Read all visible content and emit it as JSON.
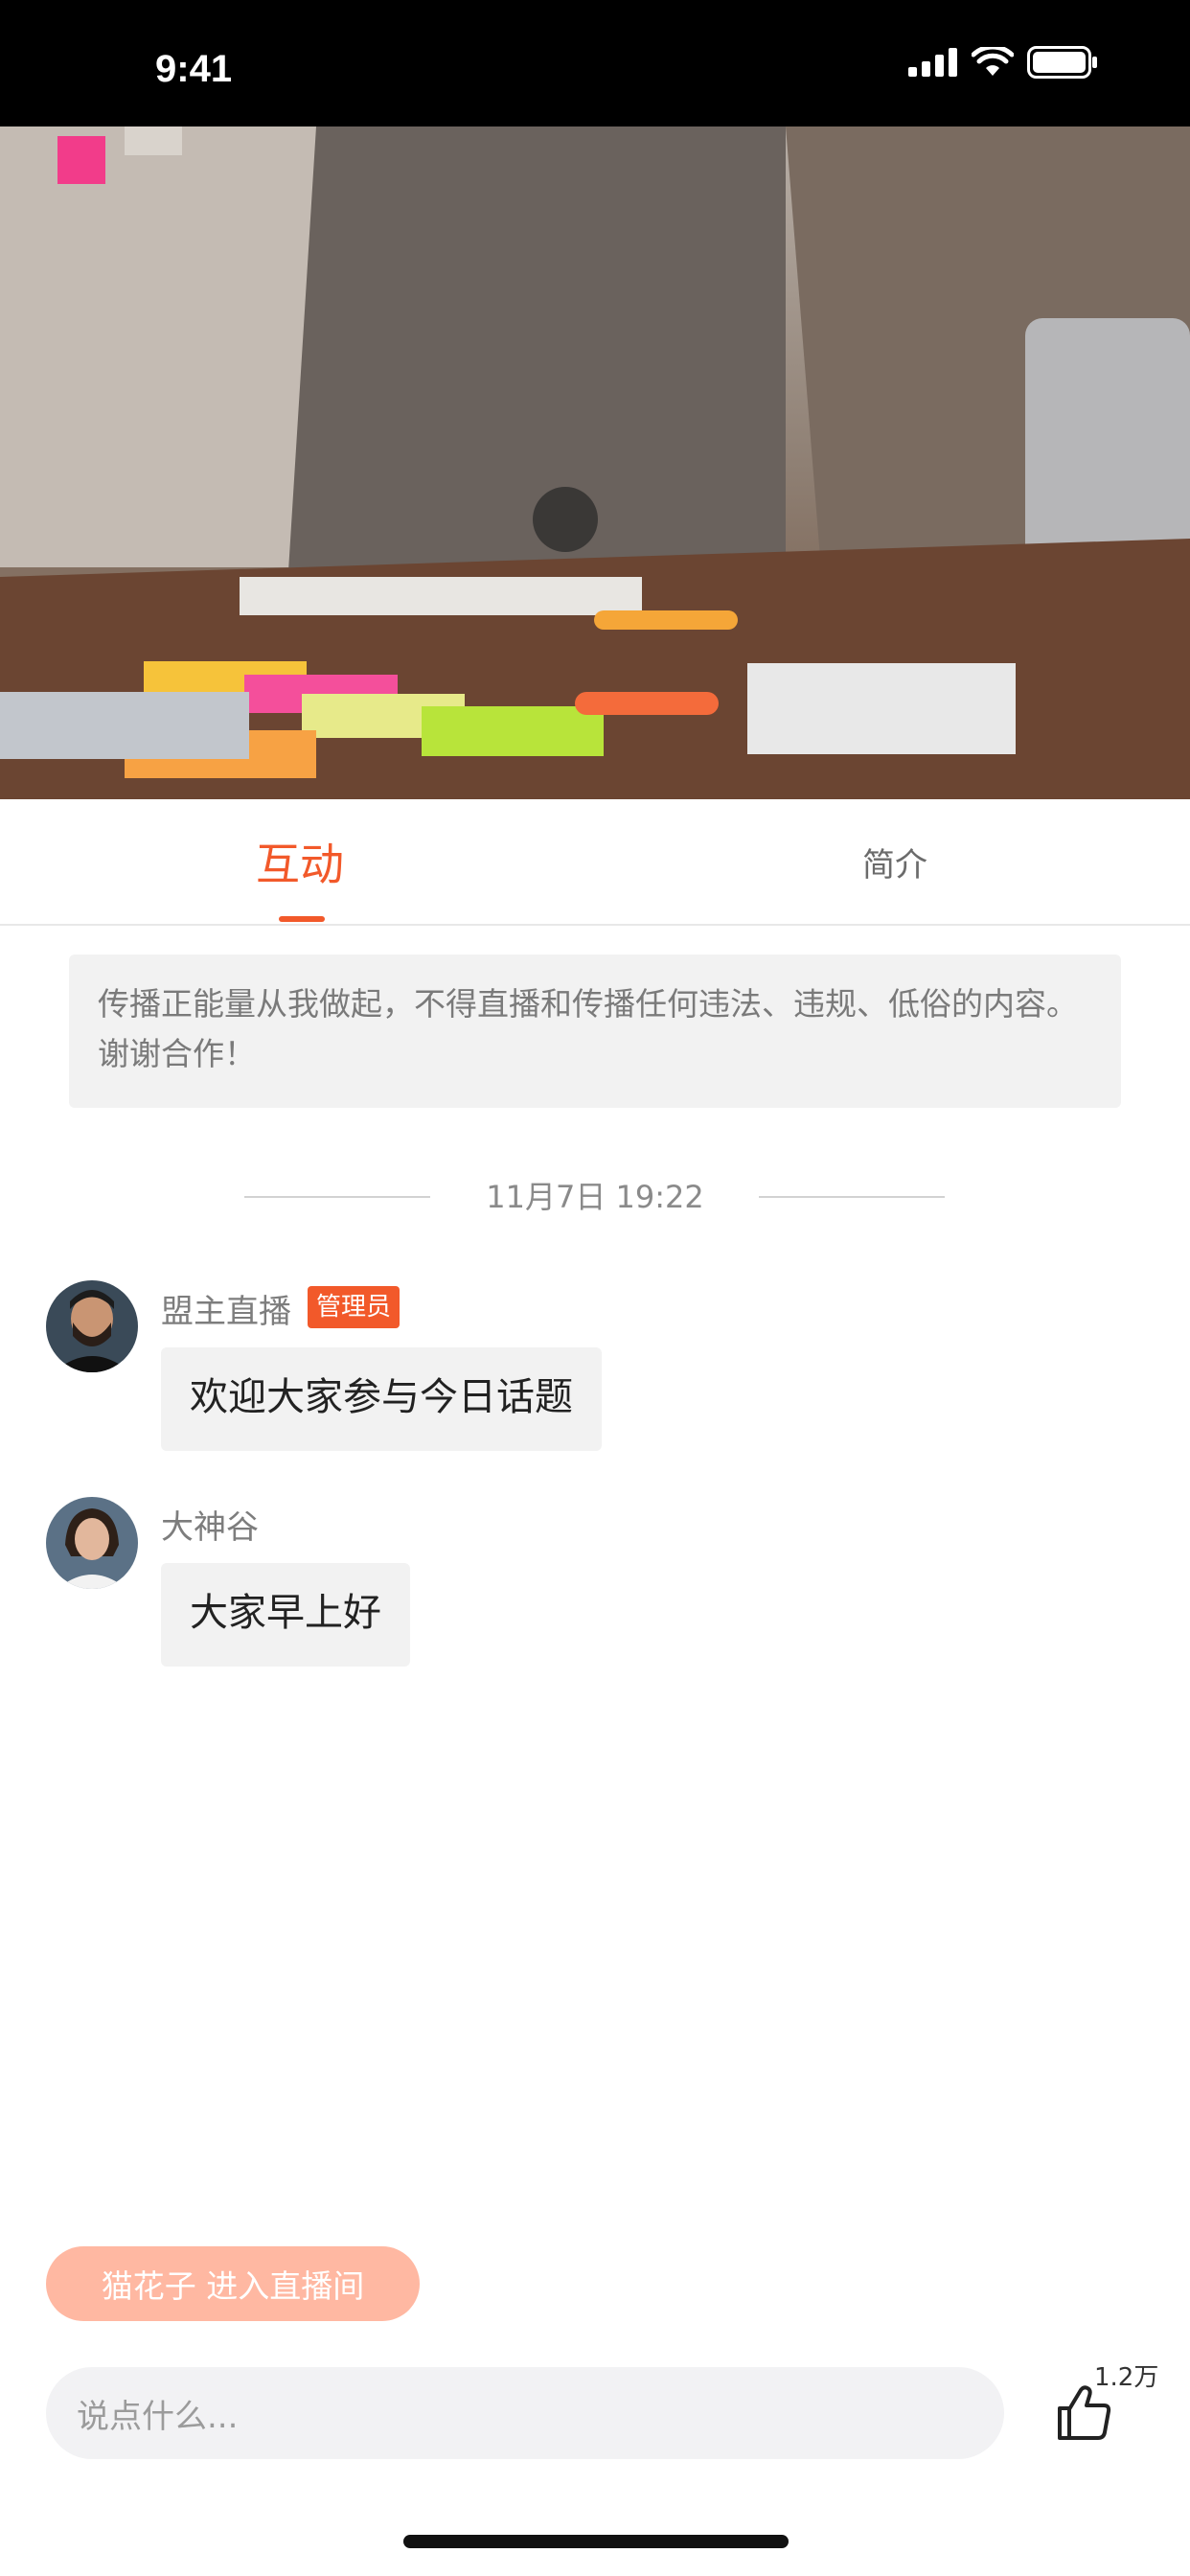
{
  "status_bar": {
    "time": "9:41"
  },
  "tabs": [
    {
      "label": "互动",
      "active": true
    },
    {
      "label": "简介",
      "active": false
    }
  ],
  "notice": {
    "text": "传播正能量从我做起，不得直播和传播任何违法、违规、低俗的内容。谢谢合作！"
  },
  "chat": {
    "date_divider": "11月7日 19:22",
    "messages": [
      {
        "user": "盟主直播",
        "badge": "管理员",
        "text": "欢迎大家参与今日话题"
      },
      {
        "user": "大神谷",
        "badge": "",
        "text": "大家早上好"
      }
    ]
  },
  "entry_notice": "猫花子 进入直播间",
  "input": {
    "placeholder": "说点什么..."
  },
  "like": {
    "count": "1.2万"
  },
  "colors": {
    "accent": "#f2592a",
    "entry_pill": "#ffb8a2",
    "bubble": "#f2f2f2"
  },
  "icons": [
    "signal-icon",
    "wifi-icon",
    "battery-icon",
    "thumbs-up-icon"
  ]
}
